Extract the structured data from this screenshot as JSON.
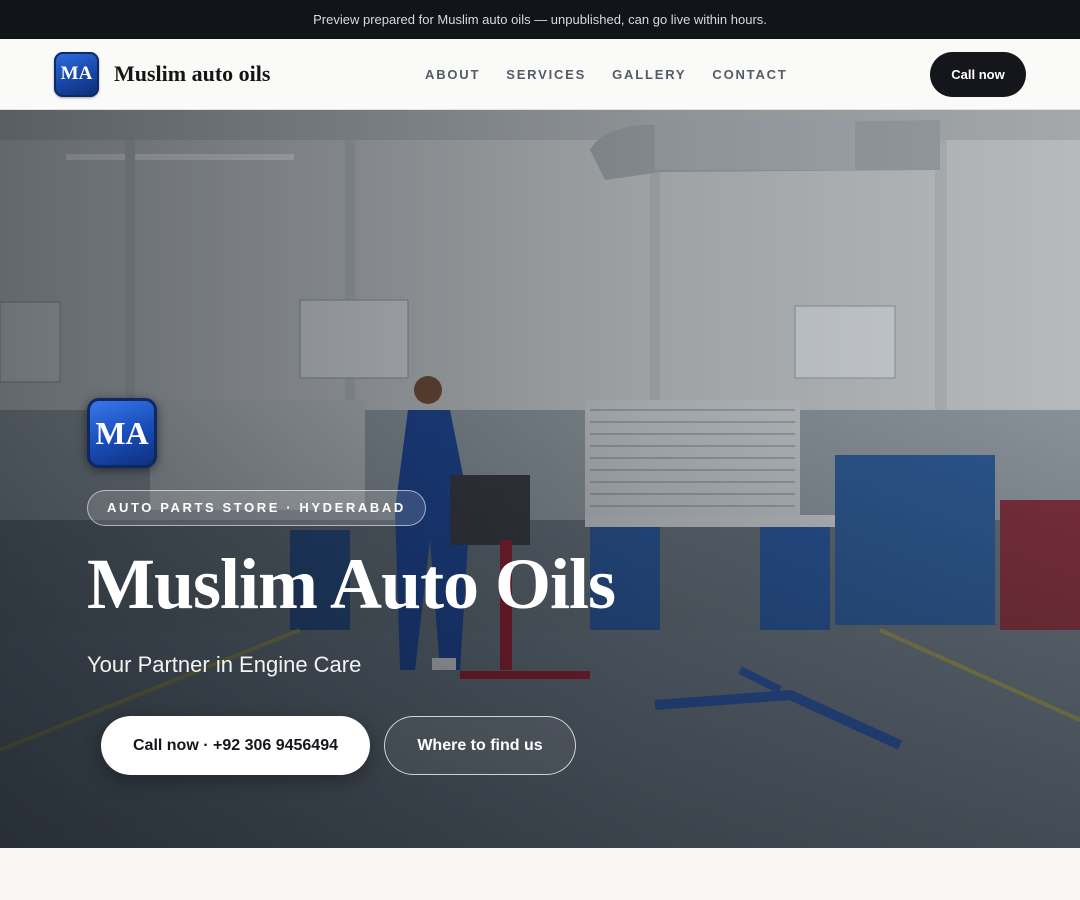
{
  "banner": {
    "text": "Preview prepared for Muslim auto oils — unpublished, can go live within hours."
  },
  "header": {
    "logo_text": "MA",
    "brand_name": "Muslim auto oils",
    "nav": [
      "ABOUT",
      "SERVICES",
      "GALLERY",
      "CONTACT"
    ],
    "cta_label": "Call now"
  },
  "hero": {
    "logo_text": "MA",
    "tag": "AUTO PARTS STORE · HYDERABAD",
    "title": "Muslim Auto Oils",
    "subtitle": "Your Partner in Engine Care",
    "primary_button": "Call now · +92 306 9456494",
    "secondary_button": "Where to find us"
  },
  "colors": {
    "dark": "#111418",
    "accent_blue": "#1b4fbc",
    "page_bg": "#f8f7f3"
  }
}
